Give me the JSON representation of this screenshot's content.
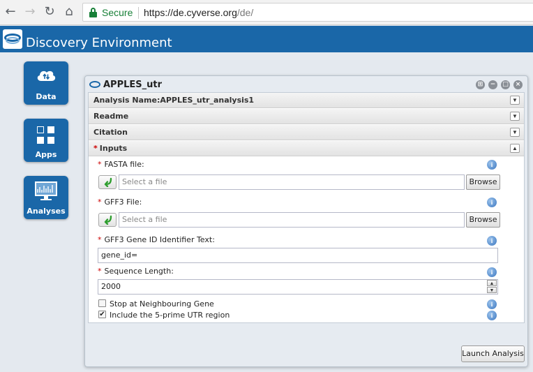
{
  "browser": {
    "secure_label": "Secure",
    "url_scheme": "https://",
    "url_host": "de.cyverse.org",
    "url_path": "/de/"
  },
  "app": {
    "title": "Discovery Environment"
  },
  "desktop": {
    "tiles": [
      {
        "label": "Data",
        "icon": "cloud-upload-icon"
      },
      {
        "label": "Apps",
        "icon": "apps-grid-icon"
      },
      {
        "label": "Analyses",
        "icon": "monitor-chart-icon"
      }
    ]
  },
  "window": {
    "title": "APPLES_utr",
    "sections": {
      "analysis_name": "Analysis Name:APPLES_utr_analysis1",
      "readme": "Readme",
      "citation": "Citation",
      "inputs_req": "*",
      "inputs": "Inputs"
    },
    "fields": {
      "fasta_label": "FASTA file:",
      "fasta_placeholder": "Select a file",
      "gff3_label": "GFF3 File:",
      "gff3_placeholder": "Select a file",
      "browse_label": "Browse",
      "gene_id_label": "GFF3 Gene ID Identifier Text:",
      "gene_id_value": "gene_id=",
      "seq_len_label": "Sequence Length:",
      "seq_len_value": "2000",
      "stop_label": "Stop at Neighbouring Gene",
      "stop_checked": false,
      "five_prime_label": "Include the 5-prime UTR region",
      "five_prime_checked": true,
      "required_mark": "*",
      "info_glyph": "i"
    },
    "launch_label": "Launch Analysis"
  },
  "colors": {
    "brand": "#1a67a8",
    "secure": "#188038",
    "required": "#cc0000"
  }
}
